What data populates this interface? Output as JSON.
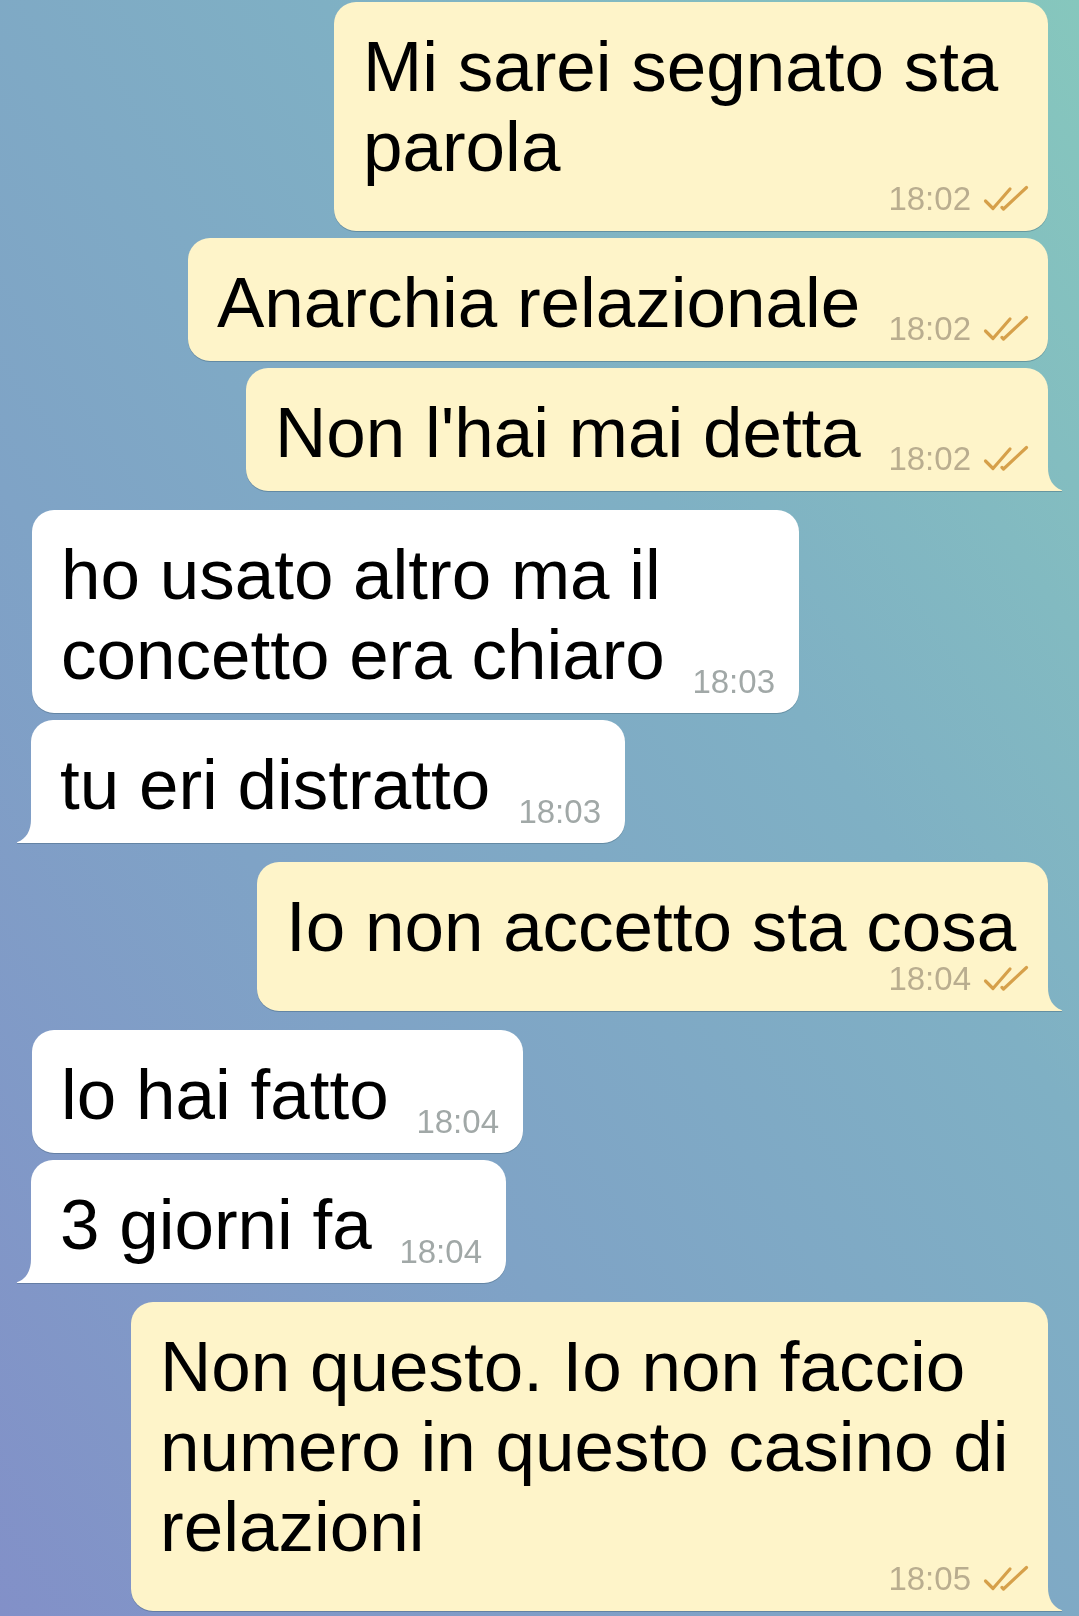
{
  "messages": [
    {
      "kind": "sent",
      "text": "Mi sarei segnato sta\nparola",
      "time": "18:02",
      "read": true
    },
    {
      "kind": "sent",
      "text": "Anarchia relazionale",
      "time": "18:02",
      "read": true
    },
    {
      "kind": "sent",
      "text": "Non l'hai mai detta",
      "time": "18:02",
      "read": true
    },
    {
      "kind": "received",
      "text": "ho usato altro ma il\nconcetto era chiaro",
      "time": "18:03"
    },
    {
      "kind": "received",
      "text": "tu eri distratto",
      "time": "18:03"
    },
    {
      "kind": "sent",
      "text": "Io non accetto sta cosa",
      "time": "18:04",
      "read": true
    },
    {
      "kind": "received",
      "text": "lo hai fatto",
      "time": "18:04"
    },
    {
      "kind": "received",
      "text": "3 giorni fa",
      "time": "18:04"
    },
    {
      "kind": "sent",
      "text": "Non questo. Io non faccio\nnumero in questo casino di\nrelazioni",
      "time": "18:05",
      "read": true
    }
  ]
}
